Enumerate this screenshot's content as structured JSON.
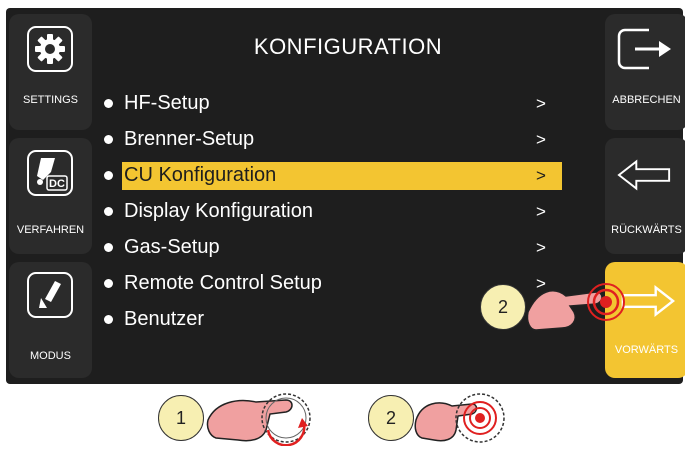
{
  "screen": {
    "title": "KONFIGURATION",
    "left_buttons": [
      {
        "label": "SETTINGS",
        "icon": "gear-icon"
      },
      {
        "label": "VERFAHREN",
        "icon": "torch-dc-icon",
        "badge": "DC"
      },
      {
        "label": "MODUS",
        "icon": "torch-mode-icon"
      }
    ],
    "right_buttons": [
      {
        "label": "ABBRECHEN",
        "icon": "exit-arrow-icon"
      },
      {
        "label": "RÜCKWÄRTS",
        "icon": "arrow-left-icon"
      },
      {
        "label": "VORWÄRTS",
        "icon": "arrow-right-icon",
        "active": true
      }
    ],
    "menu": [
      {
        "label": "HF-Setup",
        "arrow": ">"
      },
      {
        "label": "Brenner-Setup",
        "arrow": ">"
      },
      {
        "label": "CU Konfiguration",
        "arrow": ">",
        "selected": true
      },
      {
        "label": "Display Konfiguration",
        "arrow": ">"
      },
      {
        "label": "Gas-Setup",
        "arrow": ">"
      },
      {
        "label": "Remote Control Setup",
        "arrow": ">"
      },
      {
        "label": "Benutzer",
        "arrow": ""
      }
    ]
  },
  "instructions": [
    {
      "step": "1",
      "action": "rotate-knob"
    },
    {
      "step": "2",
      "action": "press-knob"
    },
    {
      "step": "2",
      "action": "press-forward-button"
    }
  ],
  "colors": {
    "accent": "#f3c531",
    "background": "#1e1e1e",
    "button": "#2b2b2b",
    "text": "#ffffff"
  }
}
